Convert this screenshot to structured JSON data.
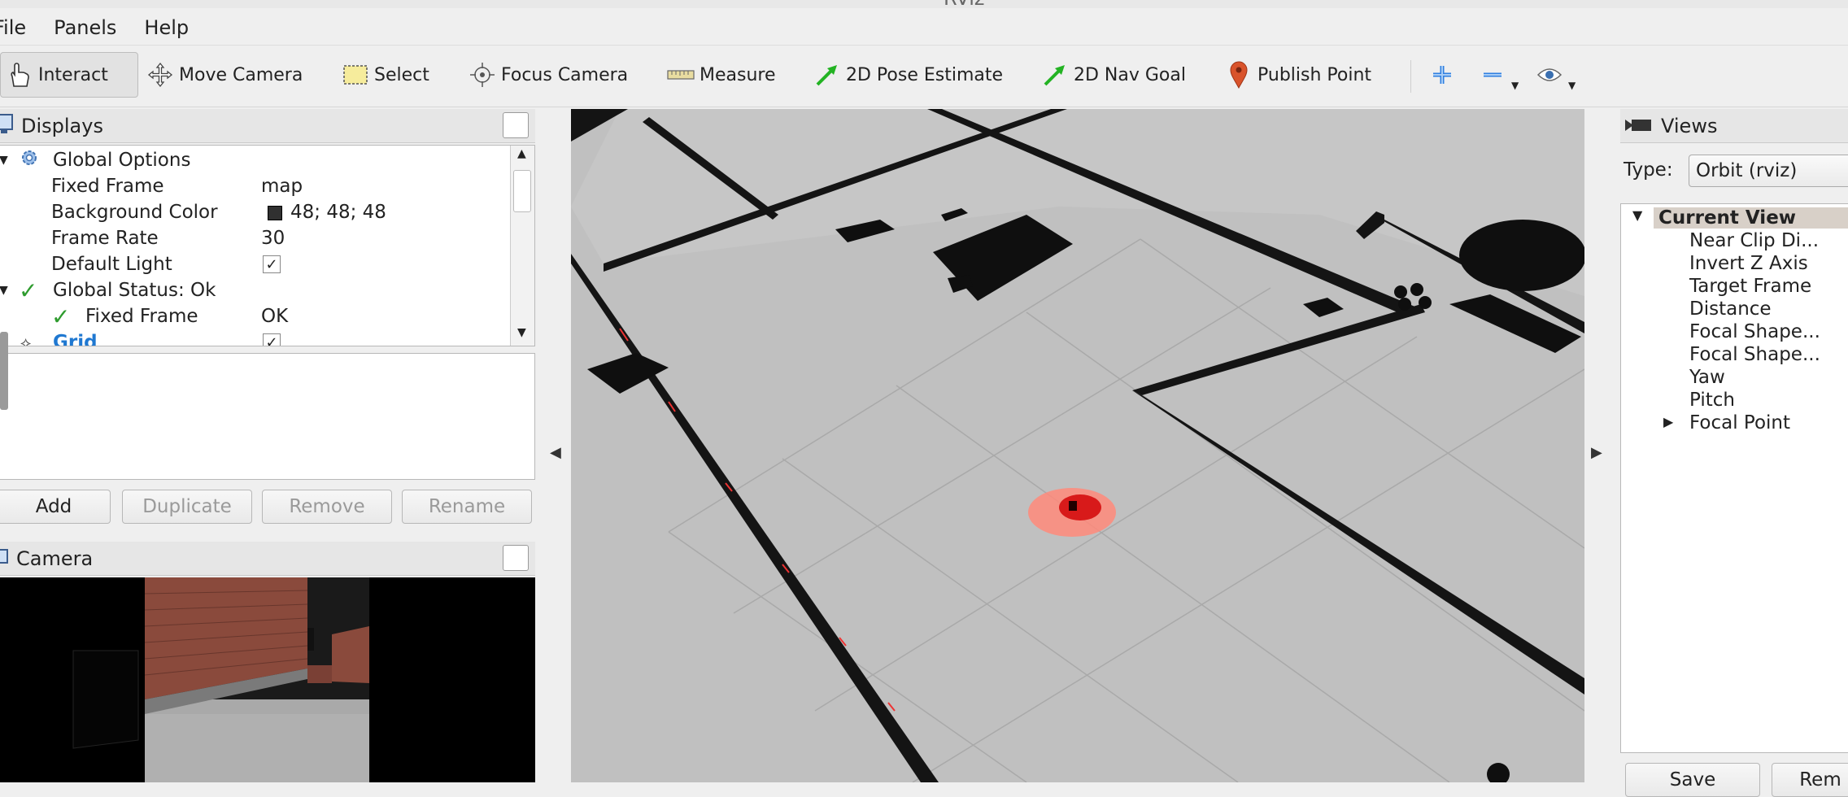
{
  "window": {
    "title": "RViz"
  },
  "menu": {
    "file": "File",
    "panels": "Panels",
    "help": "Help"
  },
  "toolbar": {
    "interact": "Interact",
    "move_camera": "Move Camera",
    "select": "Select",
    "focus_camera": "Focus Camera",
    "measure": "Measure",
    "pose_estimate": "2D Pose Estimate",
    "nav_goal": "2D Nav Goal",
    "publish_point": "Publish Point"
  },
  "displays": {
    "title": "Displays",
    "rows": [
      {
        "label": "Global Options",
        "value": ""
      },
      {
        "label": "Fixed Frame",
        "value": "map"
      },
      {
        "label": "Background Color",
        "value": "48; 48; 48"
      },
      {
        "label": "Frame Rate",
        "value": "30"
      },
      {
        "label": "Default Light",
        "value": "✓"
      },
      {
        "label": "Global Status: Ok",
        "value": ""
      },
      {
        "label": "Fixed Frame",
        "value": "OK"
      },
      {
        "label": "Grid",
        "value": "✓"
      }
    ],
    "buttons": {
      "add": "Add",
      "duplicate": "Duplicate",
      "remove": "Remove",
      "rename": "Rename"
    }
  },
  "camera": {
    "title": "Camera"
  },
  "views": {
    "title": "Views",
    "type_label": "Type:",
    "type_value": "Orbit (rviz)",
    "current_view": "Current View",
    "rows": [
      "Near Clip Di...",
      "Invert Z Axis",
      "Target Frame",
      "Distance",
      "Focal Shape...",
      "Focal Shape...",
      "Yaw",
      "Pitch",
      "Focal Point"
    ],
    "buttons": {
      "save": "Save",
      "remove": "Rem"
    }
  },
  "colors": {
    "accent": "#1f78d1",
    "ok_green": "#2e9b2e",
    "laser": "#ff4a3a"
  }
}
